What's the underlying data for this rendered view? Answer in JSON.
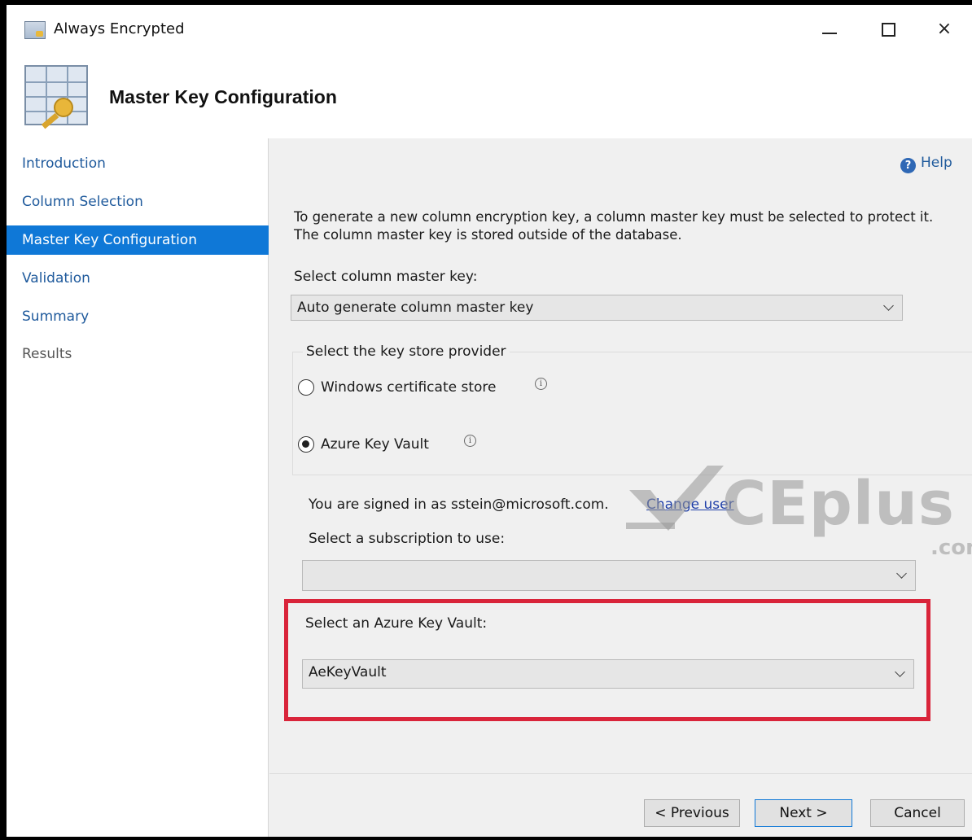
{
  "window": {
    "title": "Always Encrypted",
    "controls": {
      "minimize": "minimize",
      "maximize": "maximize",
      "close": "×"
    }
  },
  "header": {
    "title": "Master Key Configuration"
  },
  "sidebar": {
    "items": [
      {
        "label": "Introduction",
        "state": "link"
      },
      {
        "label": "Column Selection",
        "state": "link"
      },
      {
        "label": "Master Key Configuration",
        "state": "active"
      },
      {
        "label": "Validation",
        "state": "link"
      },
      {
        "label": "Summary",
        "state": "link"
      },
      {
        "label": "Results",
        "state": "disabled"
      }
    ]
  },
  "main": {
    "help_label": "Help",
    "description": "To generate a new column encryption key, a column master key must be selected to protect it.  The column master key is stored outside of the database.",
    "master_key_label": "Select column master key:",
    "master_key_value": "Auto generate column master key",
    "key_store": {
      "legend": "Select the key store provider",
      "options": [
        {
          "label": "Windows certificate store",
          "checked": false
        },
        {
          "label": "Azure Key Vault",
          "checked": true
        }
      ]
    },
    "signed_in_text": "You are signed in as sstein@microsoft.com.",
    "change_user_link": "Change user",
    "subscription_label": "Select a subscription to use:",
    "subscription_value": "",
    "key_vault_label": "Select an Azure Key Vault:",
    "key_vault_value": "AeKeyVault"
  },
  "buttons": {
    "previous": "< Previous",
    "next": "Next >",
    "cancel": "Cancel"
  },
  "watermark": {
    "text": "CEplus",
    "suffix": ".com"
  },
  "colors": {
    "accent": "#0f78d7",
    "link": "#1f5a9c",
    "highlight_border": "#d9243a"
  }
}
